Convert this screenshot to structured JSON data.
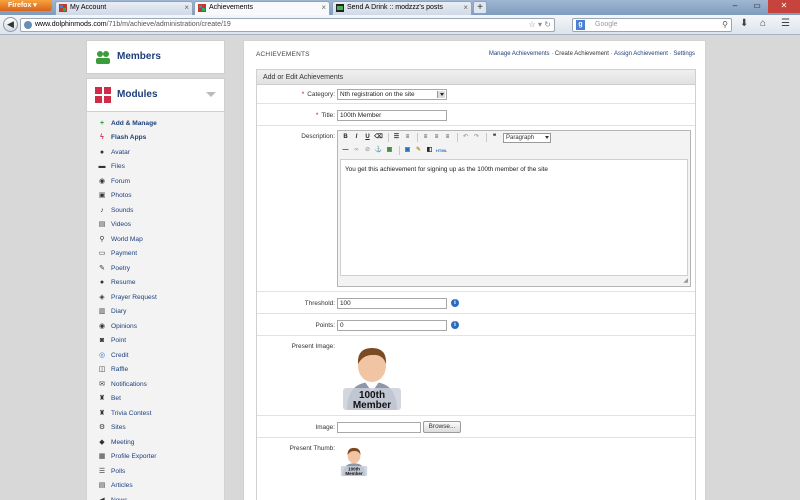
{
  "browser": {
    "menu_button": "Firefox",
    "tabs": [
      {
        "title": "My Account",
        "active": false
      },
      {
        "title": "Achievements",
        "active": true
      },
      {
        "title": "Send A Drink :: modzzz's posts",
        "active": false
      }
    ],
    "new_tab": "+",
    "url_host": "www.dolphinmods.com",
    "url_path": "/71b/m/achieve/administration/create/19",
    "search_placeholder": "Google",
    "search_engine_glyph": "g"
  },
  "sidebar": {
    "members_title": "Members",
    "modules_title": "Modules",
    "items": [
      {
        "label": "Add & Manage",
        "icon": "plus-icon",
        "bold": true
      },
      {
        "label": "Flash Apps",
        "icon": "flash-icon",
        "bold": true
      },
      {
        "label": "Avatar",
        "icon": "user-icon"
      },
      {
        "label": "Files",
        "icon": "folder-icon"
      },
      {
        "label": "Forum",
        "icon": "chat-icon"
      },
      {
        "label": "Photos",
        "icon": "image-icon"
      },
      {
        "label": "Sounds",
        "icon": "music-icon"
      },
      {
        "label": "Videos",
        "icon": "film-icon"
      },
      {
        "label": "World Map",
        "icon": "map-pin-icon"
      },
      {
        "label": "Payment",
        "icon": "card-icon"
      },
      {
        "label": "Poetry",
        "icon": "pen-icon"
      },
      {
        "label": "Resume",
        "icon": "user-icon"
      },
      {
        "label": "Prayer Request",
        "icon": "tag-icon"
      },
      {
        "label": "Diary",
        "icon": "book-icon"
      },
      {
        "label": "Opinions",
        "icon": "chat-icon"
      },
      {
        "label": "Point",
        "icon": "point-icon"
      },
      {
        "label": "Credit",
        "icon": "coin-icon"
      },
      {
        "label": "Raffle",
        "icon": "ticket-icon"
      },
      {
        "label": "Notifications",
        "icon": "mail-icon"
      },
      {
        "label": "Bet",
        "icon": "trophy-icon"
      },
      {
        "label": "Trivia Contest",
        "icon": "trophy-icon"
      },
      {
        "label": "Sites",
        "icon": "gear-icon"
      },
      {
        "label": "Meeting",
        "icon": "group-icon"
      },
      {
        "label": "Profile Exporter",
        "icon": "export-icon"
      },
      {
        "label": "Polls",
        "icon": "list-icon"
      },
      {
        "label": "Articles",
        "icon": "doc-icon"
      },
      {
        "label": "News",
        "icon": "megaphone-icon"
      }
    ]
  },
  "main": {
    "title": "ACHIEVEMENTS",
    "links": {
      "manage": "Manage Achievements",
      "create": "Create Achievement",
      "assign": "Assign Achievement",
      "settings": "Settings"
    },
    "form": {
      "title": "Add or Edit Achievements",
      "category_label": "Category:",
      "category_value": "Nth registration on the site",
      "required_mark": "*",
      "title_label": "Title:",
      "title_value": "100th Member",
      "description_label": "Description:",
      "description_value": "You get this achievement for signing up as the 100th member of the site",
      "format_value": "Paragraph",
      "threshold_label": "Threshold:",
      "threshold_value": "100",
      "points_label": "Points:",
      "points_value": "0",
      "present_image_label": "Present Image:",
      "badge_line1": "100th",
      "badge_line2": "Member",
      "image_label": "Image:",
      "browse_label": "Browse...",
      "present_thumb_label": "Present Thumb:",
      "info_glyph": "i"
    }
  }
}
